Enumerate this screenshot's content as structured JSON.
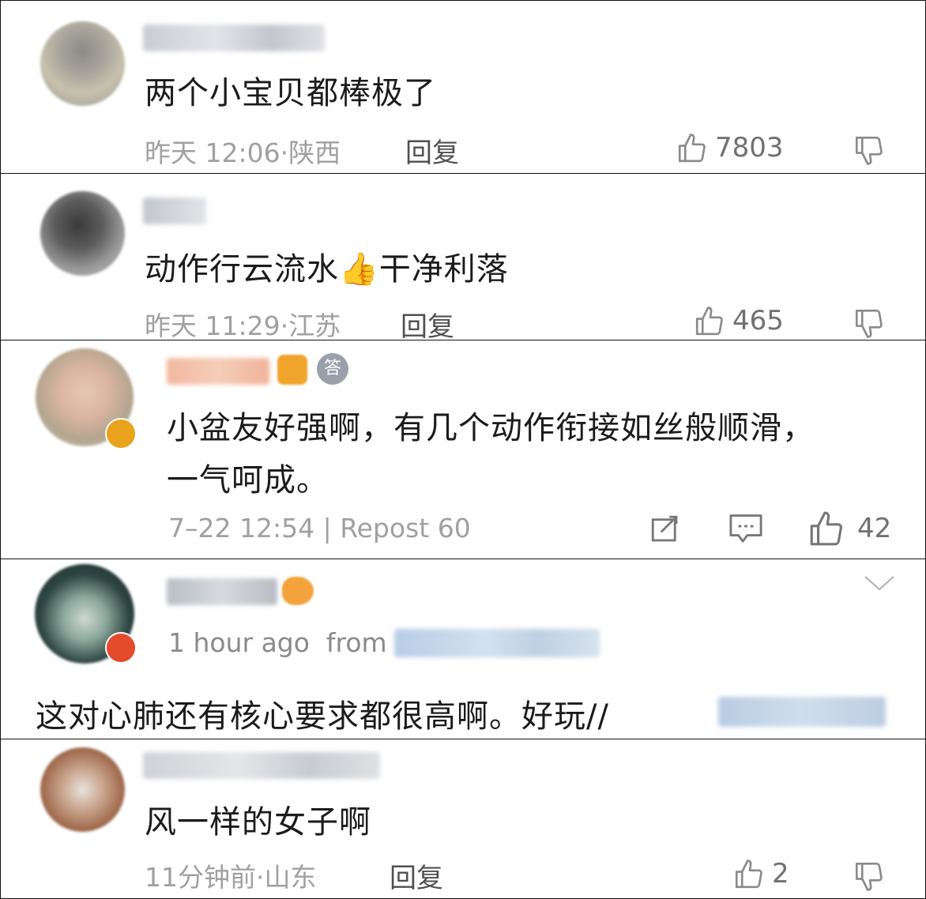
{
  "comments": [
    {
      "text": "两个小宝贝都棒极了",
      "time": "昨天 12:06·陕西",
      "reply": "回复",
      "likes": "7803"
    },
    {
      "text": "动作行云流水",
      "emoji": "👍",
      "text2": "干净利落",
      "time": "昨天 11:29·江苏",
      "reply": "回复",
      "likes": "465"
    },
    {
      "text_line1": "小盆友好强啊，有几个动作衔接如丝般顺滑，",
      "text_line2": "一气呵成。",
      "time": "7–22 12:54",
      "repost": "Repost 60",
      "likes": "42",
      "answer_badge": "答"
    },
    {
      "time": "1 hour ago",
      "from": "from",
      "text": "这对心肺还有核心要求都很高啊。好玩//"
    },
    {
      "text": "风一样的女子啊",
      "time": "11分钟前·山东",
      "reply": "回复",
      "likes": "2"
    }
  ],
  "colors": {
    "meta": "#a0a0a0",
    "badge_orange": "#e8a21c",
    "badge_red": "#e34b2b"
  },
  "icons": [
    "thumbs-up-icon",
    "thumbs-down-icon",
    "repost-icon",
    "comment-icon",
    "chevron-down-icon",
    "medal-icon",
    "verified-badge-icon"
  ]
}
